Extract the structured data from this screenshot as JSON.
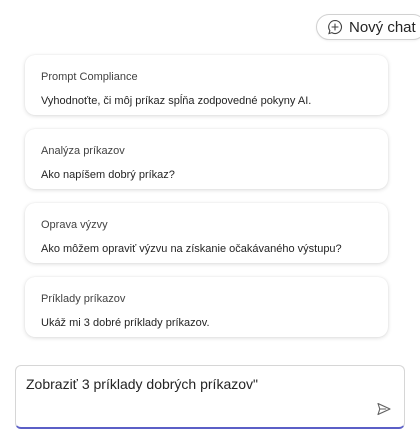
{
  "header": {
    "new_chat_label": "Nový chat",
    "new_chat_icon": "chat-add-icon"
  },
  "prompts": [
    {
      "title": "Prompt Compliance",
      "description": "Vyhodnoťte, či môj príkaz spĺňa zodpovedné pokyny AI."
    },
    {
      "title": "Analýza príkazov",
      "description": "Ako napíšem dobrý príkaz?"
    },
    {
      "title": "Oprava výzvy",
      "description": "Ako môžem opraviť výzvu na získanie očakávaného výstupu?"
    },
    {
      "title": "Príklady príkazov",
      "description": "Ukáž mi 3 dobré príklady príkazov."
    }
  ],
  "composer": {
    "value": "Zobraziť 3 príklady dobrých príkazov\"",
    "send_icon": "send-icon",
    "accent_color": "#5b5fc7"
  }
}
